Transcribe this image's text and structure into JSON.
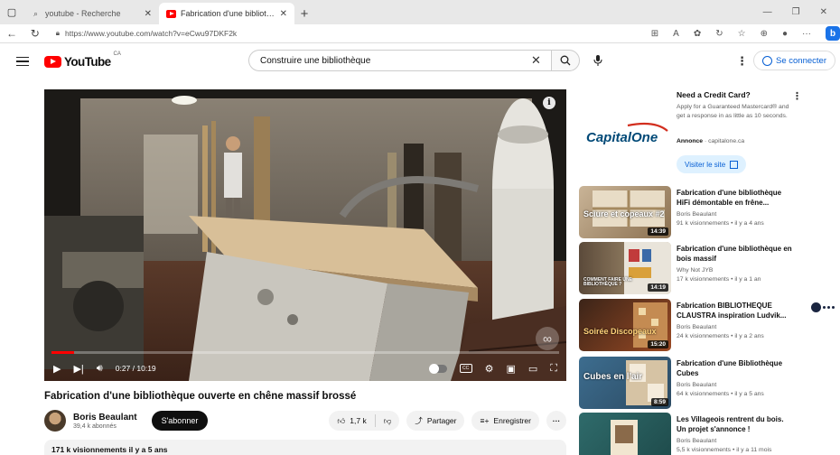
{
  "browser": {
    "tabs": [
      {
        "title": "youtube - Recherche",
        "active": false
      },
      {
        "title": "Fabrication d'une bibliothèque o",
        "active": true
      }
    ],
    "url": "https://www.youtube.com/watch?v=eCwu97DKF2k"
  },
  "header": {
    "logo": "YouTube",
    "country": "CA",
    "search_value": "Construire une bibliothèque",
    "signin_label": "Se connecter"
  },
  "player": {
    "current_time": "0:27",
    "duration": "10:19",
    "progress_fraction": 0.044
  },
  "video": {
    "title": "Fabrication d'une bibliothèque ouverte en chêne massif brossé",
    "channel": "Boris Beaulant",
    "subscribers": "39,4 k abonnés",
    "subscribe_label": "S'abonner",
    "likes": "1,7 k",
    "share_label": "Partager",
    "save_label": "Enregistrer",
    "description_meta": "171 k visionnements  il y a 5 ans"
  },
  "ad": {
    "brand": "CapitalOne",
    "title": "Need a Credit Card?",
    "description": "Apply for a Guaranteed Mastercard® and get a response in as little as 10 seconds.",
    "sponsor_label": "Annonce",
    "sponsor_domain": "capitalone.ca",
    "cta_label": "Visiter le site"
  },
  "related": [
    {
      "title": "Fabrication d'une bibliothèque HiFi démontable en frêne...",
      "channel": "Boris Beaulant",
      "meta": "91 k visionnements • il y a 4 ans",
      "duration": "14:39",
      "overlay": "Sciure et copeaux #2"
    },
    {
      "title": "Fabrication d'une bibliothèque en bois massif",
      "channel": "Why Not JYB",
      "meta": "17 k visionnements • il y a 1 an",
      "duration": "14:19",
      "overlay": "COMMENT FAIRE UNE BIBLIOTHÈQUE ?"
    },
    {
      "title": "Fabrication BIBLIOTHEQUE CLAUSTRA inspiration Ludvik...",
      "channel": "Boris Beaulant",
      "meta": "24 k visionnements • il y a 2 ans",
      "duration": "15:20",
      "overlay": "Soirée Discopeaux"
    },
    {
      "title": "Fabrication d'une Bibliothèque Cubes",
      "channel": "Boris Beaulant",
      "meta": "64 k visionnements • il y a 5 ans",
      "duration": "8:59",
      "overlay": "Cubes en l'air"
    },
    {
      "title": "Les Villageois rentrent du bois. Un projet s'annonce !",
      "channel": "Boris Beaulant",
      "meta": "5,5 k visionnements • il y a 11 mois",
      "duration": "",
      "overlay": ""
    }
  ]
}
